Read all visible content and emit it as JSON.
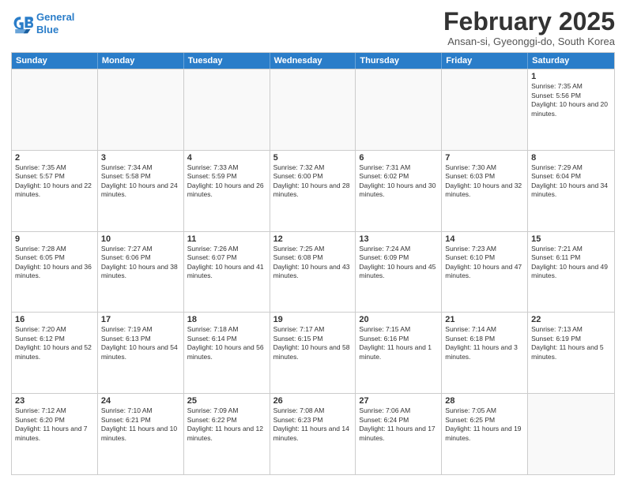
{
  "header": {
    "logo_line1": "General",
    "logo_line2": "Blue",
    "month_year": "February 2025",
    "location": "Ansan-si, Gyeonggi-do, South Korea"
  },
  "days_of_week": [
    "Sunday",
    "Monday",
    "Tuesday",
    "Wednesday",
    "Thursday",
    "Friday",
    "Saturday"
  ],
  "weeks": [
    [
      {
        "day": "",
        "info": ""
      },
      {
        "day": "",
        "info": ""
      },
      {
        "day": "",
        "info": ""
      },
      {
        "day": "",
        "info": ""
      },
      {
        "day": "",
        "info": ""
      },
      {
        "day": "",
        "info": ""
      },
      {
        "day": "1",
        "info": "Sunrise: 7:35 AM\nSunset: 5:56 PM\nDaylight: 10 hours and 20 minutes."
      }
    ],
    [
      {
        "day": "2",
        "info": "Sunrise: 7:35 AM\nSunset: 5:57 PM\nDaylight: 10 hours and 22 minutes."
      },
      {
        "day": "3",
        "info": "Sunrise: 7:34 AM\nSunset: 5:58 PM\nDaylight: 10 hours and 24 minutes."
      },
      {
        "day": "4",
        "info": "Sunrise: 7:33 AM\nSunset: 5:59 PM\nDaylight: 10 hours and 26 minutes."
      },
      {
        "day": "5",
        "info": "Sunrise: 7:32 AM\nSunset: 6:00 PM\nDaylight: 10 hours and 28 minutes."
      },
      {
        "day": "6",
        "info": "Sunrise: 7:31 AM\nSunset: 6:02 PM\nDaylight: 10 hours and 30 minutes."
      },
      {
        "day": "7",
        "info": "Sunrise: 7:30 AM\nSunset: 6:03 PM\nDaylight: 10 hours and 32 minutes."
      },
      {
        "day": "8",
        "info": "Sunrise: 7:29 AM\nSunset: 6:04 PM\nDaylight: 10 hours and 34 minutes."
      }
    ],
    [
      {
        "day": "9",
        "info": "Sunrise: 7:28 AM\nSunset: 6:05 PM\nDaylight: 10 hours and 36 minutes."
      },
      {
        "day": "10",
        "info": "Sunrise: 7:27 AM\nSunset: 6:06 PM\nDaylight: 10 hours and 38 minutes."
      },
      {
        "day": "11",
        "info": "Sunrise: 7:26 AM\nSunset: 6:07 PM\nDaylight: 10 hours and 41 minutes."
      },
      {
        "day": "12",
        "info": "Sunrise: 7:25 AM\nSunset: 6:08 PM\nDaylight: 10 hours and 43 minutes."
      },
      {
        "day": "13",
        "info": "Sunrise: 7:24 AM\nSunset: 6:09 PM\nDaylight: 10 hours and 45 minutes."
      },
      {
        "day": "14",
        "info": "Sunrise: 7:23 AM\nSunset: 6:10 PM\nDaylight: 10 hours and 47 minutes."
      },
      {
        "day": "15",
        "info": "Sunrise: 7:21 AM\nSunset: 6:11 PM\nDaylight: 10 hours and 49 minutes."
      }
    ],
    [
      {
        "day": "16",
        "info": "Sunrise: 7:20 AM\nSunset: 6:12 PM\nDaylight: 10 hours and 52 minutes."
      },
      {
        "day": "17",
        "info": "Sunrise: 7:19 AM\nSunset: 6:13 PM\nDaylight: 10 hours and 54 minutes."
      },
      {
        "day": "18",
        "info": "Sunrise: 7:18 AM\nSunset: 6:14 PM\nDaylight: 10 hours and 56 minutes."
      },
      {
        "day": "19",
        "info": "Sunrise: 7:17 AM\nSunset: 6:15 PM\nDaylight: 10 hours and 58 minutes."
      },
      {
        "day": "20",
        "info": "Sunrise: 7:15 AM\nSunset: 6:16 PM\nDaylight: 11 hours and 1 minute."
      },
      {
        "day": "21",
        "info": "Sunrise: 7:14 AM\nSunset: 6:18 PM\nDaylight: 11 hours and 3 minutes."
      },
      {
        "day": "22",
        "info": "Sunrise: 7:13 AM\nSunset: 6:19 PM\nDaylight: 11 hours and 5 minutes."
      }
    ],
    [
      {
        "day": "23",
        "info": "Sunrise: 7:12 AM\nSunset: 6:20 PM\nDaylight: 11 hours and 7 minutes."
      },
      {
        "day": "24",
        "info": "Sunrise: 7:10 AM\nSunset: 6:21 PM\nDaylight: 11 hours and 10 minutes."
      },
      {
        "day": "25",
        "info": "Sunrise: 7:09 AM\nSunset: 6:22 PM\nDaylight: 11 hours and 12 minutes."
      },
      {
        "day": "26",
        "info": "Sunrise: 7:08 AM\nSunset: 6:23 PM\nDaylight: 11 hours and 14 minutes."
      },
      {
        "day": "27",
        "info": "Sunrise: 7:06 AM\nSunset: 6:24 PM\nDaylight: 11 hours and 17 minutes."
      },
      {
        "day": "28",
        "info": "Sunrise: 7:05 AM\nSunset: 6:25 PM\nDaylight: 11 hours and 19 minutes."
      },
      {
        "day": "",
        "info": ""
      }
    ]
  ]
}
